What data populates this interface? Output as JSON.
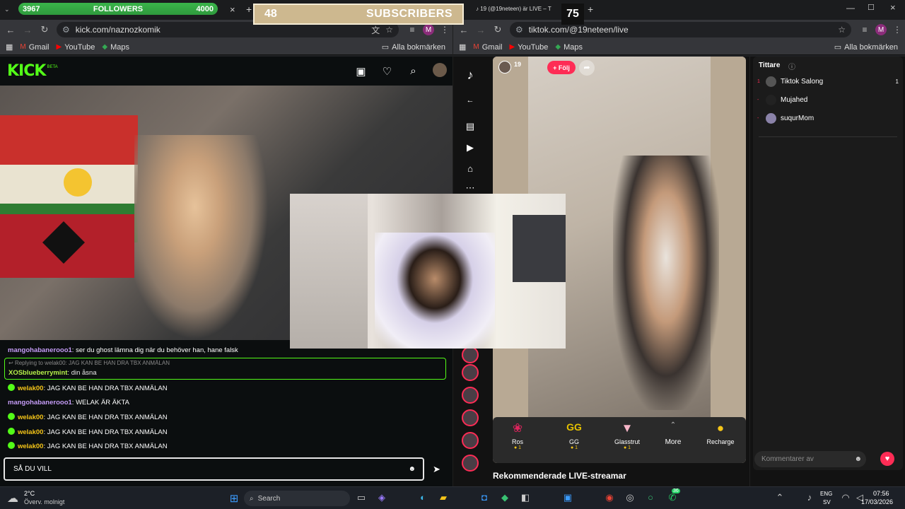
{
  "overlays": {
    "followers": {
      "current": "3967",
      "label": "FOLLOWERS",
      "goal": "4000",
      "progress": 0.99
    },
    "subscribers": {
      "current": "48",
      "label": "SUBSCRIBERS",
      "goal": "75"
    }
  },
  "left_window": {
    "tab_close": "×",
    "tab_new": "+",
    "url": "kick.com/naznozkomik",
    "avatar": "M",
    "bookmarks": [
      "Gmail",
      "YouTube",
      "Maps"
    ],
    "all_bookmarks": "Alla bokmärken"
  },
  "right_window": {
    "tab_title": "19 (@19neteen) är LIVE – T",
    "url": "tiktok.com/@19neteen/live",
    "avatar": "M",
    "bookmarks": [
      "Gmail",
      "YouTube",
      "Maps"
    ],
    "all_bookmarks": "Alla bokmärken"
  },
  "kick": {
    "logo": "KICK",
    "beta": "BETA",
    "chat": [
      {
        "user": "mangohabanerooo1",
        "text": ": ser du ghost lämna dig när du behöver han, hane falsk",
        "color": "purple"
      },
      {
        "reply_to": "Replying to welak00: JAG KAN BE HAN DRA TBX ANMÄLAN",
        "user": "XOSblueberrymint",
        "text": ": din åsna"
      },
      {
        "user": "welak00",
        "text": ": JAG KAN BE HAN DRA TBX ANMÄLAN",
        "badge": true
      },
      {
        "user": "mangohabanerooo1",
        "text": ": WELAK ÄR ÄKTA"
      },
      {
        "user": "welak00",
        "text": ": JAG KAN BE HAN DRA TBX ANMÄLAN",
        "badge": true
      },
      {
        "user": "welak00",
        "text": ": JAG KAN BE HAN DRA TBX ANMÄLAN",
        "badge": true
      },
      {
        "user": "welak00",
        "text": ": JAG KAN BE HAN DRA TBX ANMÄLAN",
        "badge": true
      }
    ],
    "input_value": "SÅ DU VILL"
  },
  "tiktok": {
    "host_name": "19",
    "follow_label": "+ Följ",
    "gifts": [
      {
        "name": "Ros",
        "coins": "1"
      },
      {
        "name": "GG",
        "coins": "1"
      },
      {
        "name": "Glasstrut",
        "coins": "1"
      }
    ],
    "more_label": "More",
    "recharge_label": "Recharge",
    "recommended_title": "Rekommenderade LIVE-streamar",
    "viewers_title": "Tittare",
    "viewers": [
      {
        "rank": "1",
        "name": "Tiktok Salong",
        "count": "1"
      },
      {
        "rank": "-",
        "name": "Mujahed"
      },
      {
        "rank": "-",
        "name": "suqurMom"
      }
    ],
    "comment_placeholder": "Kommentarer av"
  },
  "taskbar": {
    "weather_temp": "2°C",
    "weather_desc": "Överv. molnigt",
    "search_label": "Search",
    "lang_top": "ENG",
    "lang_bottom": "SV",
    "time": "07:56",
    "date": "17/03/2026",
    "whatsapp_badge": "36"
  }
}
